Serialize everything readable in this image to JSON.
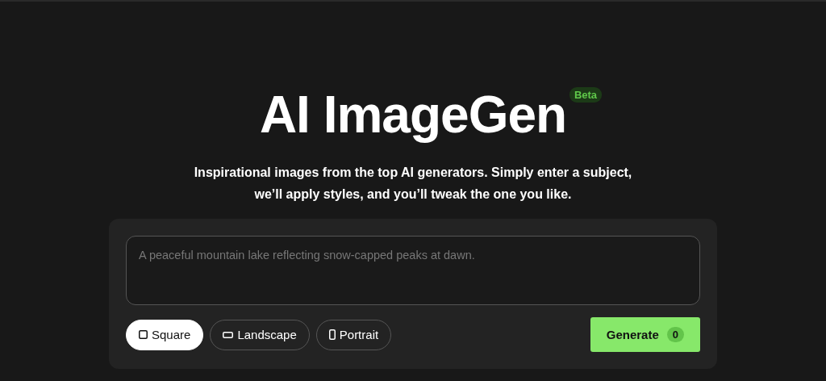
{
  "title": "AI ImageGen",
  "badge": "Beta",
  "subtitle": "Inspirational images from the top AI generators. Simply enter a subject, we’ll apply styles, and you’ll tweak the one you like.",
  "prompt": {
    "placeholder": "A peaceful mountain lake reflecting snow-capped peaks at dawn."
  },
  "shapes": [
    {
      "kind": "square",
      "label": "Square",
      "selected": true
    },
    {
      "kind": "landscape",
      "label": "Landscape",
      "selected": false
    },
    {
      "kind": "portrait",
      "label": "Portrait",
      "selected": false
    }
  ],
  "generate": {
    "label": "Generate",
    "count": "0"
  }
}
